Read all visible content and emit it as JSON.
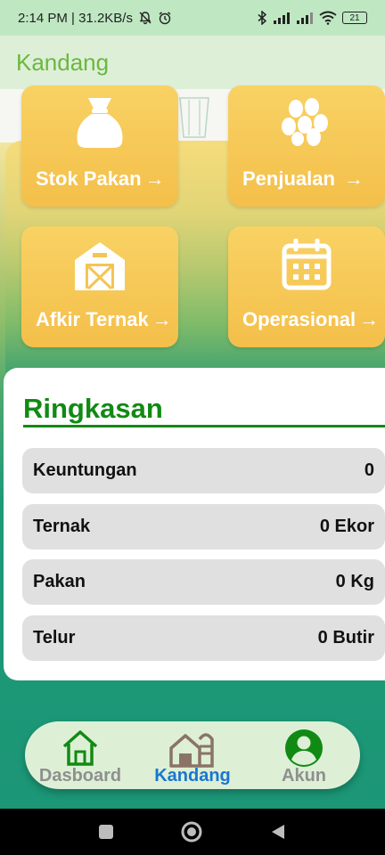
{
  "status_bar": {
    "time_speed": "2:14 PM | 31.2KB/s",
    "battery": "21",
    "icons": [
      "bell-off-icon",
      "alarm-icon",
      "bluetooth-icon",
      "signal-icon",
      "signal-icon",
      "wifi-icon",
      "battery-icon"
    ]
  },
  "app_bar": {
    "title": "Kandang"
  },
  "menu": [
    {
      "label": "Stok Pakan",
      "icon": "feed-sack-icon"
    },
    {
      "label": "Penjualan",
      "icon": "eggs-icon"
    },
    {
      "label": "Afkir Ternak",
      "icon": "barn-icon"
    },
    {
      "label": "Operasional",
      "icon": "calendar-icon"
    }
  ],
  "summary": {
    "title": "Ringkasan",
    "rows": [
      {
        "label": "Keuntungan",
        "value": "0"
      },
      {
        "label": "Ternak",
        "value": "0 Ekor"
      },
      {
        "label": "Pakan",
        "value": "0 Kg"
      },
      {
        "label": "Telur",
        "value": "0 Butir"
      }
    ]
  },
  "bottom_nav": {
    "items": [
      {
        "label": "Dasboard",
        "icon": "home-icon",
        "active": false
      },
      {
        "label": "Kandang",
        "icon": "farm-icon",
        "active": true
      },
      {
        "label": "Akun",
        "icon": "account-icon",
        "active": false
      }
    ],
    "active_color": "#1976d2",
    "inactive_color": "#8f8f8f",
    "icon_color": "#118a14"
  },
  "colors": {
    "accent": "#118a14",
    "card": "#f4bf4a",
    "app_title": "#6ab83f"
  }
}
